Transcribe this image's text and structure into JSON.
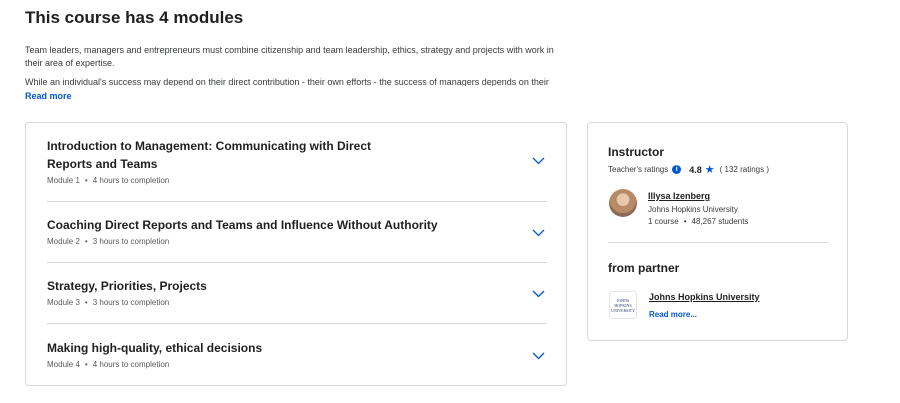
{
  "page": {
    "heading": "This course has 4 modules",
    "description": [
      "Team leaders, managers and entrepreneurs must combine citizenship and team leadership, ethics, strategy and projects with work in their area of expertise.",
      "While an individual's success may depend on their direct contribution - their own efforts - the success of managers depends on their"
    ],
    "read_more": "Read more"
  },
  "modules": [
    {
      "title": "Introduction to Management: Communicating with Direct Reports and Teams",
      "number": "Module 1",
      "duration": "4 hours to completion"
    },
    {
      "title": "Coaching Direct Reports and Teams and Influence Without Authority",
      "number": "Module 2",
      "duration": "3 hours to completion"
    },
    {
      "title": "Strategy, Priorities, Projects",
      "number": "Module 3",
      "duration": "3 hours to completion"
    },
    {
      "title": "Making high-quality, ethical decisions",
      "number": "Module 4",
      "duration": "4 hours to completion"
    }
  ],
  "meta_separator": "•",
  "instructor": {
    "heading": "Instructor",
    "ratings_label": "Teacher's ratings",
    "rating": "4.8",
    "rating_count": "( 132 ratings )",
    "name": "Illysa Izenberg",
    "org": "Johns Hopkins University",
    "courses": "1 course",
    "students": "48,267 students"
  },
  "partner": {
    "heading": "from partner",
    "name": "Johns Hopkins University",
    "read_more": "Read more...",
    "logo_text": [
      "JOHNS",
      "HOPKINS",
      "UNIVERSITY"
    ]
  },
  "colors": {
    "accent": "#0056d2",
    "border": "#dadada",
    "text": "#1f1f1f"
  },
  "icons": {
    "chevron": "chevron-down-icon",
    "info": "info-icon",
    "star": "star-icon"
  }
}
